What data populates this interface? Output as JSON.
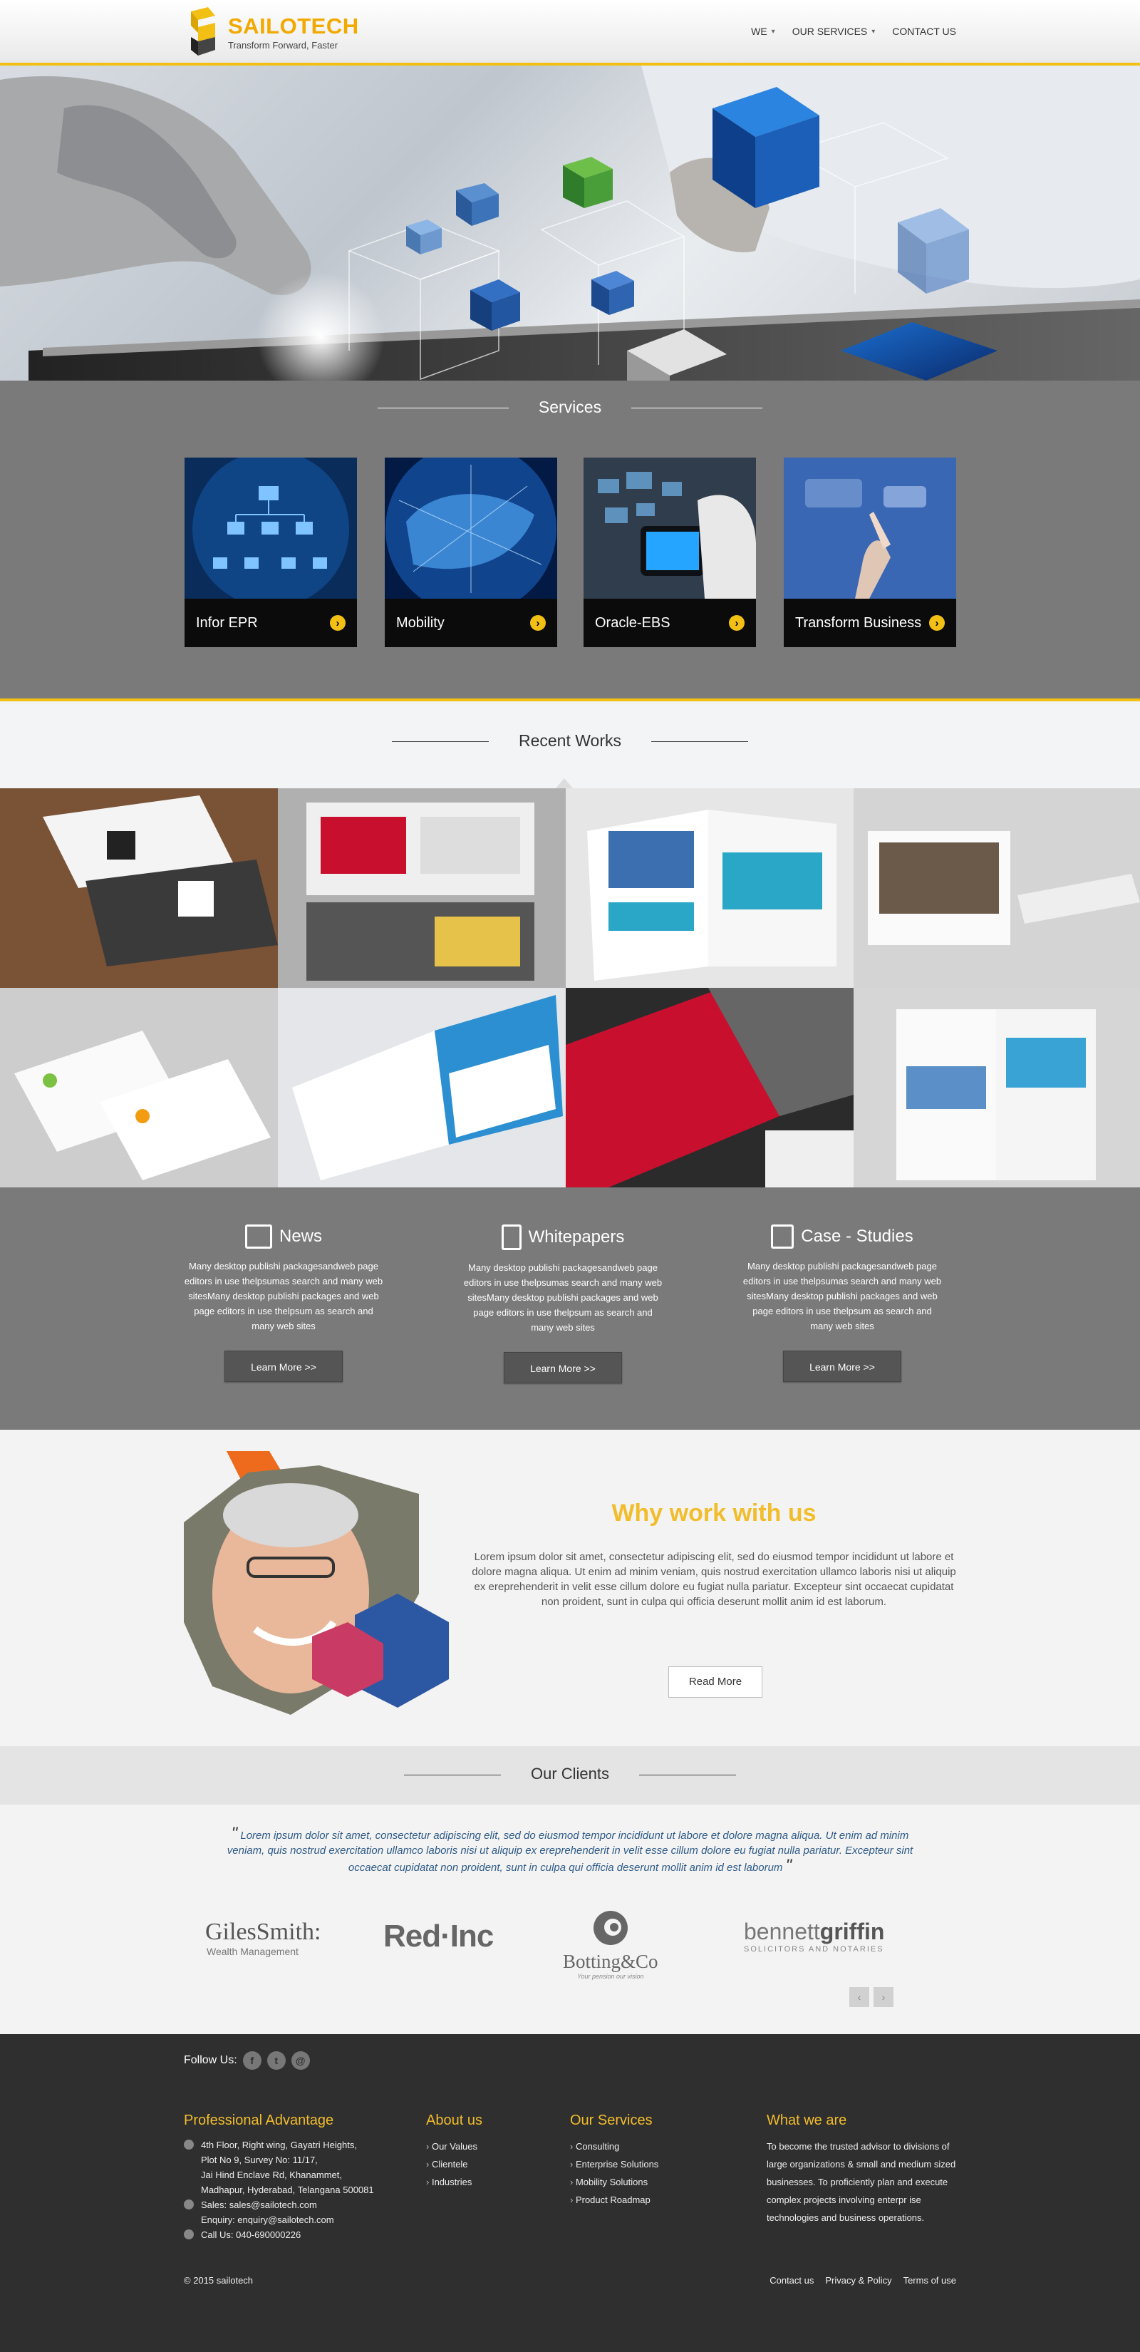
{
  "header": {
    "brand": "SAILOTECH",
    "tagline": "Transform Forward, Faster",
    "nav": [
      {
        "label": "WE",
        "dropdown": true
      },
      {
        "label": "OUR SERVICES",
        "dropdown": true
      },
      {
        "label": "CONTACT US",
        "dropdown": false
      }
    ]
  },
  "services": {
    "title": "Services",
    "cards": [
      {
        "label": "Infor EPR"
      },
      {
        "label": "Mobility"
      },
      {
        "label": "Oracle-EBS"
      },
      {
        "label": "Transform Business"
      }
    ]
  },
  "works": {
    "title": "Recent Works"
  },
  "resources": [
    {
      "title": "News",
      "icon": "news-icon",
      "text": "Many desktop publishi packagesandweb page editors in use thelpsumas search and many web sitesMany desktop publishi packages and web page editors in use thelpsum as search and many web sites",
      "button": "Learn More >>"
    },
    {
      "title": "Whitepapers",
      "icon": "document-icon",
      "text": "Many desktop publishi packagesandweb page editors in use thelpsumas search and many web sitesMany desktop publishi packages and web page editors in use thelpsum as search and many web sites",
      "button": "Learn More >>"
    },
    {
      "title": "Case - Studies",
      "icon": "case-study-icon",
      "text": "Many desktop publishi packagesandweb page editors in use thelpsumas search and many web sitesMany desktop publishi packages and web page editors in use thelpsum as search and many web sites",
      "button": "Learn More >>"
    }
  ],
  "why": {
    "title": "Why work with us",
    "text": "Lorem ipsum dolor sit amet, consectetur adipiscing elit, sed do eiusmod tempor incididunt ut labore et dolore magna aliqua. Ut enim ad minim veniam, quis nostrud exercitation ullamco laboris nisi ut aliquip ex ereprehenderit in velit esse cillum dolore eu fugiat nulla pariatur. Excepteur sint occaecat cupidatat non proident, sunt in culpa qui officia deserunt mollit anim id est laborum.",
    "button": "Read More"
  },
  "clients": {
    "title": "Our Clients",
    "quote": "Lorem ipsum dolor sit amet, consectetur adipiscing elit, sed do eiusmod tempor incididunt ut labore et dolore magna aliqua. Ut enim ad minim veniam, quis nostrud exercitation ullamco laboris nisi ut aliquip ex ereprehenderit in velit esse cillum dolore eu fugiat nulla pariatur. Excepteur sint occaecat cupidatat non proident, sunt in culpa qui officia deserunt mollit anim id est laborum",
    "logos": [
      {
        "name": "GilesSmith:",
        "sub": "Wealth Management"
      },
      {
        "name": "Red·Inc",
        "sub": ""
      },
      {
        "name": "Botting&Co",
        "sub": "Your pension our vision"
      },
      {
        "name_a": "bennett",
        "name_b": "griffin",
        "sub": "SOLICITORS AND NOTARIES"
      }
    ],
    "prev": "‹",
    "next": "›"
  },
  "footer": {
    "follow_label": "Follow Us:",
    "social": [
      {
        "icon": "facebook-icon",
        "glyph": "f"
      },
      {
        "icon": "twitter-icon",
        "glyph": "t"
      },
      {
        "icon": "email-icon",
        "glyph": "@"
      }
    ],
    "professional": {
      "title": "Professional Advantage",
      "address_lines": [
        "4th Floor, Right wing, Gayatri Heights,",
        "Plot No 9, Survey No: 11/17,",
        "Jai Hind Enclave Rd, Khanammet,",
        "Madhapur, Hyderabad, Telangana 500081"
      ],
      "sales": "Sales: sales@sailotech.com",
      "enquiry": "Enquiry: enquiry@sailotech.com",
      "call": "Call Us: 040-690000226"
    },
    "about": {
      "title": "About us",
      "links": [
        "Our Values",
        "Clientele",
        "Industries"
      ]
    },
    "our_services": {
      "title": "Our Services",
      "links": [
        "Consulting",
        "Enterprise Solutions",
        "Mobility Solutions",
        "Product Roadmap"
      ]
    },
    "what": {
      "title": "What we are",
      "text": "To become the trusted advisor to divisions of large organizations & small and medium sized businesses. To proficiently plan and execute complex projects involving enterpr ise technologies and business operations."
    },
    "copyright": "© 2015 sailotech",
    "bottom_links": [
      "Contact us",
      "Privacy & Policy",
      "Terms of use"
    ]
  },
  "colors": {
    "accent": "#f2c014",
    "why_title": "#f2bd2c",
    "gray_band": "#7a7a7a",
    "footer": "#2f2f2f"
  }
}
